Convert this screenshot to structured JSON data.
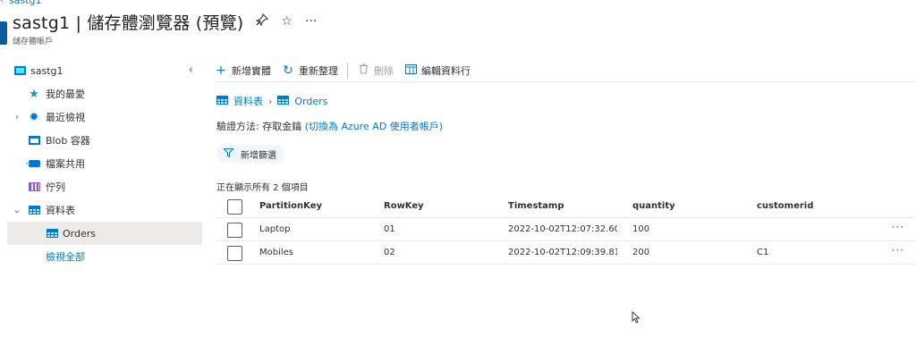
{
  "top_crumb": {
    "label": "sastg1"
  },
  "header": {
    "title": "sastg1 | 儲存體瀏覽器 (預覽)",
    "subtitle": "儲存體帳戶",
    "pin_icon": "pin-icon",
    "favorite_icon": "star-icon",
    "more_icon": "ellipsis-icon"
  },
  "sidebar": {
    "collapse_icon": "chevron-left-icon",
    "items": [
      {
        "label": "sastg1",
        "icon": "storage-account-icon"
      },
      {
        "label": "我的最愛",
        "icon": "star-icon"
      },
      {
        "label": "最近檢視",
        "icon": "gear-icon",
        "chevron": "›"
      },
      {
        "label": "Blob 容器",
        "icon": "blob-container-icon"
      },
      {
        "label": "檔案共用",
        "icon": "file-share-icon"
      },
      {
        "label": "佇列",
        "icon": "queue-icon"
      },
      {
        "label": "資料表",
        "icon": "table-icon",
        "chevron": "⌄"
      },
      {
        "label": "Orders",
        "icon": "table-icon",
        "selected": true
      },
      {
        "label": "檢視全部"
      }
    ]
  },
  "toolbar": {
    "add_entity": "新增實體",
    "refresh": "重新整理",
    "delete": "刪除",
    "edit_columns": "編輯資料行"
  },
  "breadcrumb": {
    "tables": "資料表",
    "current": "Orders"
  },
  "auth": {
    "prefix": "驗證方法: 存取金鑰",
    "switch_link": "(切換為 Azure AD 使用者帳戶)"
  },
  "filter": {
    "label": "新增篩選"
  },
  "grid": {
    "count_text": "正在顯示所有 2 個項目",
    "columns": [
      "PartitionKey",
      "RowKey",
      "Timestamp",
      "quantity",
      "customerid"
    ],
    "rows": [
      {
        "PartitionKey": "Laptop",
        "RowKey": "01",
        "Timestamp": "2022-10-02T12:07:32.60...",
        "quantity": "100",
        "customerid": ""
      },
      {
        "PartitionKey": "Mobiles",
        "RowKey": "02",
        "Timestamp": "2022-10-02T12:09:39.81...",
        "quantity": "200",
        "customerid": "C1"
      }
    ],
    "row_more": "···"
  },
  "colors": {
    "accent": "#0078d4",
    "selected_bg": "#edebe9",
    "filter_bg": "#eff6fc"
  }
}
